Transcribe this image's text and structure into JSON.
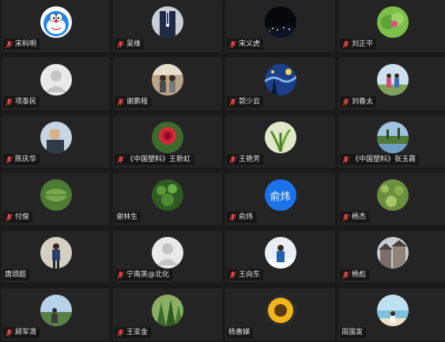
{
  "participants": [
    {
      "name": "宋科明",
      "avatar": "doraemon",
      "muted": true
    },
    {
      "name": "吴维",
      "avatar": "photo-suit",
      "muted": true
    },
    {
      "name": "宋义虎",
      "avatar": "photo-night-city",
      "muted": true
    },
    {
      "name": "刘正平",
      "avatar": "photo-leaf-flower",
      "muted": true
    },
    {
      "name": "项泰民",
      "avatar": "default-person",
      "muted": true
    },
    {
      "name": "谢鹏程",
      "avatar": "photo-people-indoor",
      "muted": true
    },
    {
      "name": "郭少云",
      "avatar": "photo-starry-night",
      "muted": true
    },
    {
      "name": "刘春太",
      "avatar": "photo-couple-outdoor",
      "muted": true
    },
    {
      "name": "陈庆华",
      "avatar": "photo-man-portrait",
      "muted": true
    },
    {
      "name": "《中国塑料》王新虹",
      "avatar": "photo-red-roses",
      "muted": true
    },
    {
      "name": "王艳芳",
      "avatar": "photo-plant-sun",
      "muted": true
    },
    {
      "name": "《中国塑料》张玉霞",
      "avatar": "photo-lake-scene",
      "muted": true
    },
    {
      "name": "付俊",
      "avatar": "photo-green-leaf",
      "muted": true
    },
    {
      "name": "谢林生",
      "avatar": "photo-green-plant",
      "muted": false
    },
    {
      "name": "俞炜",
      "avatar": "text-initials",
      "avatar_text": "俞炜",
      "avatar_color": "#1a73e8",
      "muted": true
    },
    {
      "name": "杨杰",
      "avatar": "photo-moss",
      "muted": true
    },
    {
      "name": "唐颂超",
      "avatar": "photo-man-standing",
      "muted": false
    },
    {
      "name": "宁南英@北化",
      "avatar": "default-person",
      "muted": true
    },
    {
      "name": "王向东",
      "avatar": "photo-man-snow",
      "muted": true
    },
    {
      "name": "杨彪",
      "avatar": "photo-buildings",
      "muted": true
    },
    {
      "name": "顾军渭",
      "avatar": "photo-landscape",
      "muted": true
    },
    {
      "name": "王亚金",
      "avatar": "photo-forest",
      "muted": true
    },
    {
      "name": "杨惠娣",
      "avatar": "photo-sunflower",
      "muted": false
    },
    {
      "name": "周国发",
      "avatar": "photo-beach",
      "muted": false
    }
  ],
  "colors": {
    "background": "#1a1a1a",
    "tile": "#242424",
    "mic_muted": "#e04343"
  }
}
